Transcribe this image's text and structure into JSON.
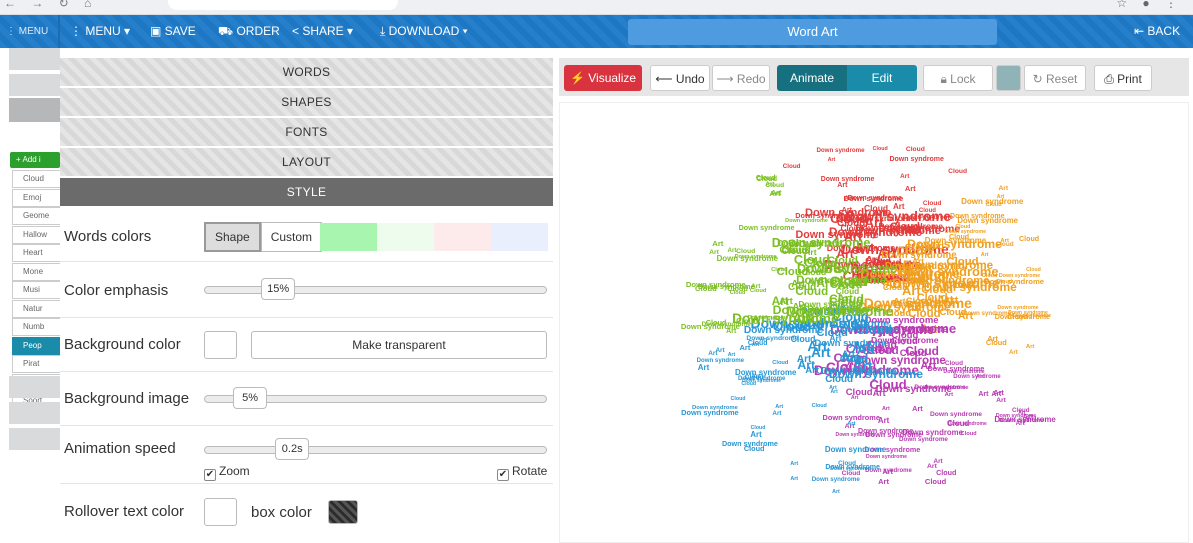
{
  "toolbar": {
    "menu_left": "MENU",
    "menu": "MENU",
    "save": "SAVE",
    "order": "ORDER",
    "share": "SHARE",
    "download": "DOWNLOAD",
    "title": "Word Art",
    "back": "BACK"
  },
  "sidebar": {
    "add_label": "Add i",
    "items": [
      "Cloud",
      "Emoj",
      "Geome",
      "Hallow",
      "Heart",
      "Mone",
      "Musi",
      "Natur",
      "Numb",
      "Peop",
      "Pirat",
      "Schoo",
      "Soort"
    ],
    "active_index": 9
  },
  "panel": {
    "sections": [
      "WORDS",
      "SHAPES",
      "FONTS",
      "LAYOUT",
      "STYLE"
    ],
    "active_section": "STYLE",
    "words_colors_label": "Words colors",
    "shape_btn": "Shape",
    "custom_btn": "Custom",
    "swatches": [
      "#a8f5b0",
      "#eefcee",
      "#fdeaea",
      "#e9effc"
    ],
    "color_emphasis_label": "Color emphasis",
    "color_emphasis_value": "15%",
    "color_emphasis_fraction": 0.15,
    "background_color_label": "Background color",
    "make_transparent": "Make transparent",
    "background_image_label": "Background image",
    "background_image_value": "5%",
    "background_image_fraction": 0.05,
    "animation_speed_label": "Animation speed",
    "animation_speed_value": "0.2s",
    "animation_speed_fraction": 0.2,
    "zoom_label": "Zoom",
    "rotate_label": "Rotate",
    "rollover_label": "Rollover text color",
    "box_color_label": "box color"
  },
  "actions": {
    "visualize": "Visualize",
    "undo": "Undo",
    "redo": "Redo",
    "animate": "Animate",
    "edit": "Edit",
    "lock": "Lock",
    "reset": "Reset",
    "print": "Print",
    "visualize_color": "#d9333f",
    "accent_color": "#1a8ba8"
  },
  "wordcloud": {
    "words": [
      "Art",
      "Cloud",
      "Down syndrome"
    ],
    "colors": {
      "red": "#e23b3b",
      "orange": "#f0a020",
      "green": "#7cbf24",
      "blue": "#2a97d4",
      "magenta": "#b93bb3"
    }
  }
}
